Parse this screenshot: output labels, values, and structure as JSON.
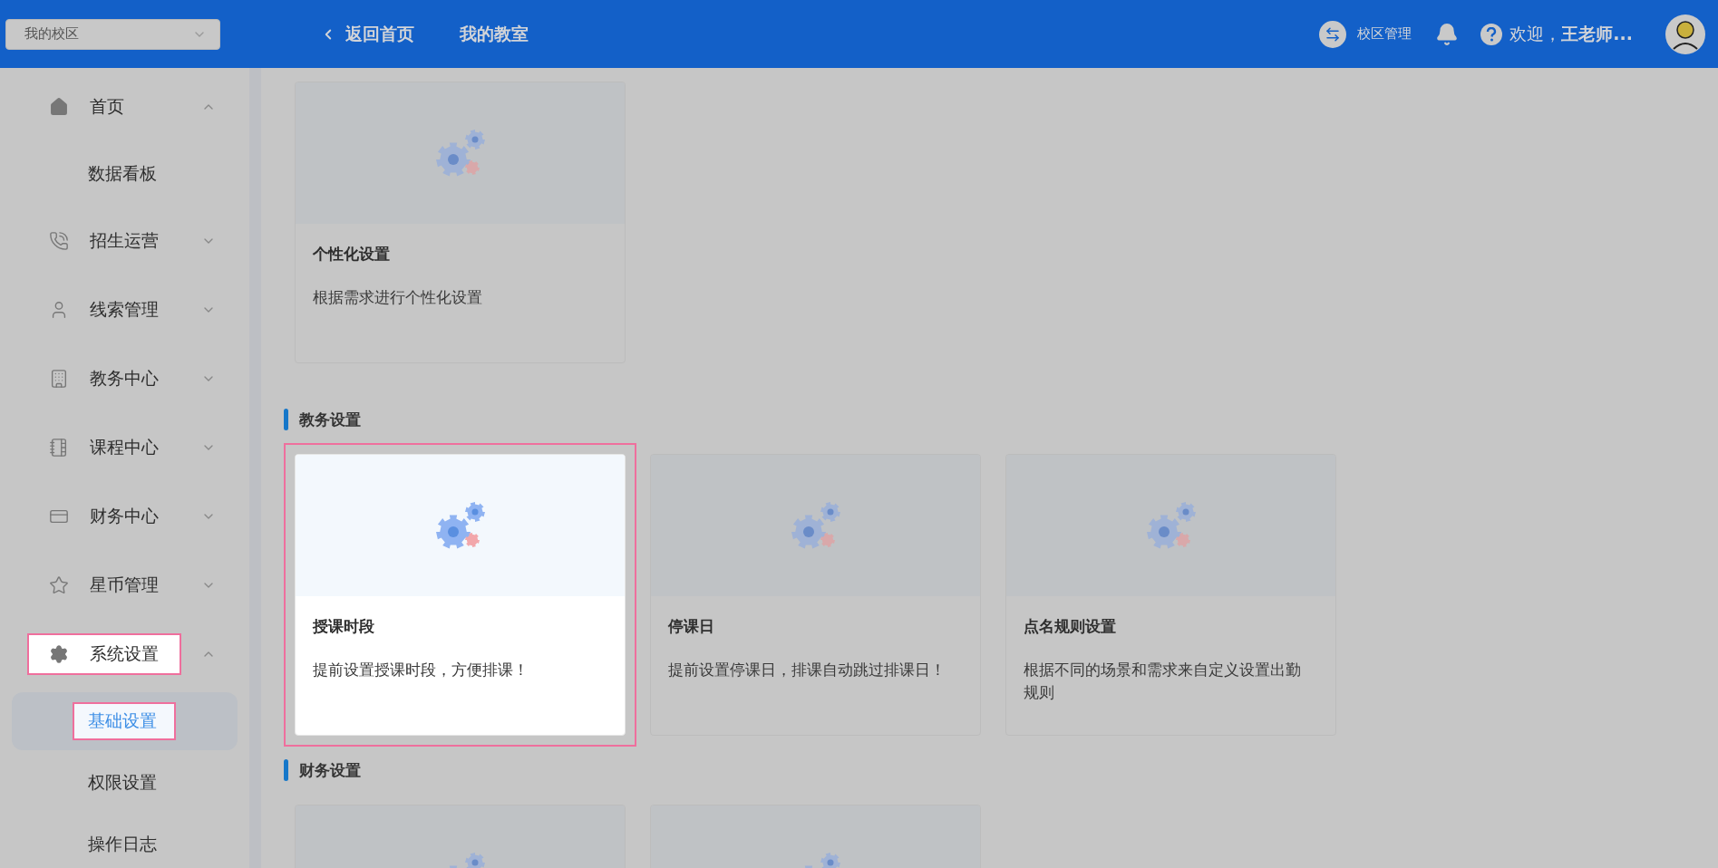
{
  "header": {
    "campus_select": {
      "value": "我的校区"
    },
    "back_link": "返回首页",
    "classroom_link": "我的教室",
    "campus_manage": "校区管理",
    "welcome": "欢迎，**王老师...**"
  },
  "sidebar": {
    "items": [
      {
        "label": "首页",
        "expanded": true,
        "spotlight": false,
        "children": [
          {
            "label": "数据看板",
            "selected": false,
            "spotlight": false
          }
        ]
      },
      {
        "label": "招生运营",
        "expanded": false,
        "spotlight": false
      },
      {
        "label": "线索管理",
        "expanded": false,
        "spotlight": false
      },
      {
        "label": "教务中心",
        "expanded": false,
        "spotlight": false
      },
      {
        "label": "课程中心",
        "expanded": false,
        "spotlight": false
      },
      {
        "label": "财务中心",
        "expanded": false,
        "spotlight": false
      },
      {
        "label": "星币管理",
        "expanded": false,
        "spotlight": false
      },
      {
        "label": "系统设置",
        "expanded": true,
        "spotlight": true,
        "children": [
          {
            "label": "基础设置",
            "selected": true,
            "spotlight": true
          },
          {
            "label": "权限设置",
            "selected": false,
            "spotlight": false
          },
          {
            "label": "操作日志",
            "selected": false,
            "spotlight": false
          }
        ]
      }
    ]
  },
  "sections": [
    {
      "cards": [
        {
          "title": "个性化设置",
          "description": "根据需求进行个性化设置",
          "spotlight": false
        }
      ]
    },
    {
      "title": "教务设置",
      "cards": [
        {
          "title": "授课时段",
          "description": "提前设置授课时段，方便排课！",
          "spotlight": true
        },
        {
          "title": "停课日",
          "description": "提前设置停课日，排课自动跳过排课日！",
          "spotlight": false
        },
        {
          "title": "点名规则设置",
          "description": "根据不同的场景和需求来自定义设置出勤规则",
          "spotlight": false
        }
      ]
    },
    {
      "title": "财务设置",
      "cards": [
        {
          "spotlight": false
        },
        {
          "spotlight": false
        }
      ]
    }
  ]
}
